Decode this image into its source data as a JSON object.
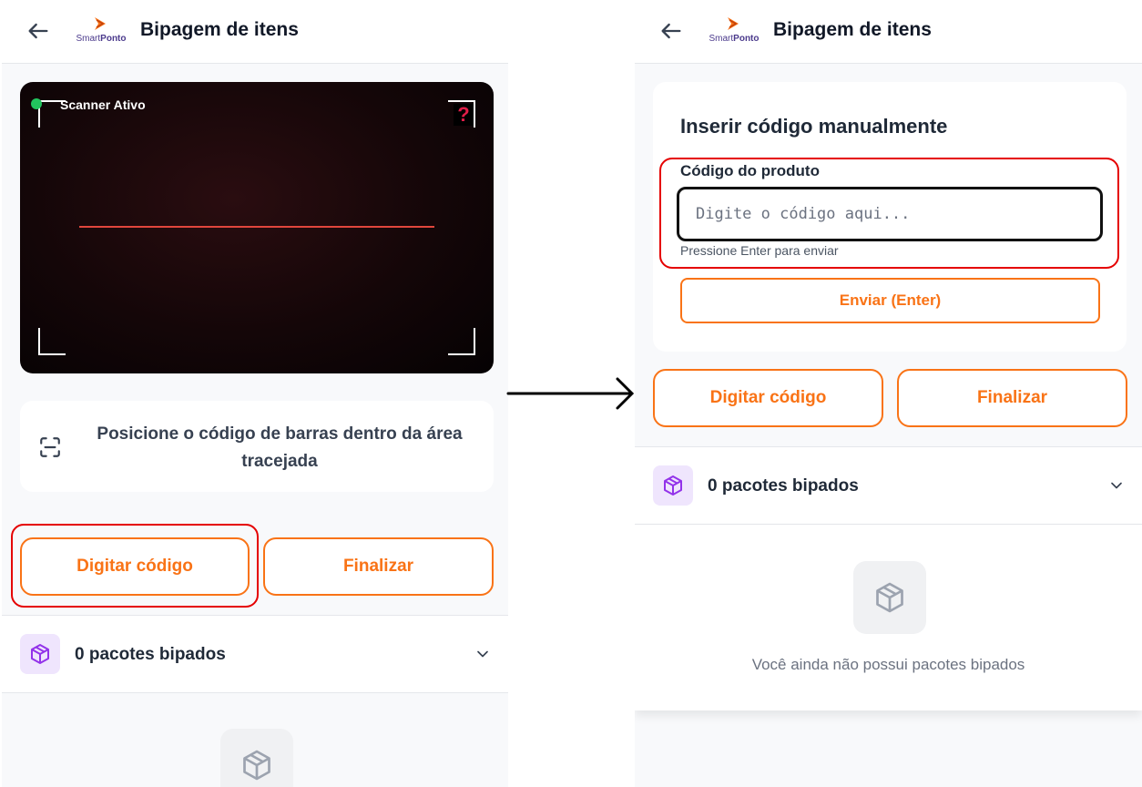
{
  "left_screen": {
    "header": {
      "title": "Bipagem de itens",
      "logo_word_1": "Smart",
      "logo_word_2": "Ponto"
    },
    "scanner": {
      "status_label": "Scanner Ativo",
      "help_label": "?"
    },
    "hint": {
      "text": "Posicione o código de barras dentro da área tracejada"
    },
    "actions": {
      "type_code_label": "Digitar código",
      "finish_label": "Finalizar"
    },
    "packages": {
      "label": "0 pacotes bipados"
    }
  },
  "right_screen": {
    "header": {
      "title": "Bipagem de itens",
      "logo_word_1": "Smart",
      "logo_word_2": "Ponto"
    },
    "manual_entry": {
      "title": "Inserir código manualmente",
      "field_label": "Código do produto",
      "input_value": "",
      "input_placeholder": "Digite o código aqui...",
      "help_text": "Pressione Enter para enviar",
      "submit_label": "Enviar (Enter)"
    },
    "actions": {
      "type_code_label": "Digitar código",
      "finish_label": "Finalizar"
    },
    "packages": {
      "label": "0 pacotes bipados",
      "empty_message": "Você ainda não possui pacotes bipados"
    }
  },
  "colors": {
    "accent": "#f97316",
    "highlight": "#e50000",
    "scanner_ok": "#22c55e",
    "package_icon": "#9333ea"
  },
  "icons": [
    "arrow-left-icon",
    "smartponto-logo",
    "question-icon",
    "scan-icon",
    "package-icon",
    "chevron-down-icon",
    "transition-arrow-icon"
  ]
}
